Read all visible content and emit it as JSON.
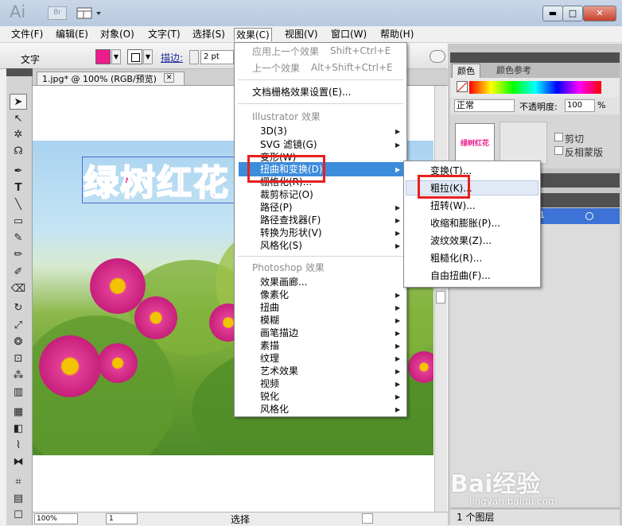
{
  "app": {
    "logo": "Ai",
    "bridge": "Br"
  },
  "window_controls": {
    "minimize": "▬",
    "maximize": "□",
    "close": "✕"
  },
  "menubar": [
    "文件(F)",
    "编辑(E)",
    "对象(O)",
    "文字(T)",
    "选择(S)",
    "效果(C)",
    "视图(V)",
    "窗口(W)",
    "帮助(H)"
  ],
  "control_bar": {
    "mode": "文字",
    "fill_color": "#ec1c8c",
    "stroke_label": "描边:",
    "stroke_value": "2 pt"
  },
  "document_tab": {
    "title": "1.jpg* @ 100% (RGB/预览)",
    "close": "✕"
  },
  "artwork": {
    "text": "绿树红花"
  },
  "status_bar": {
    "zoom": "100%",
    "page": "1",
    "mode": "选择"
  },
  "effects_menu": {
    "apply_last": "应用上一个效果",
    "apply_last_shortcut": "Shift+Ctrl+E",
    "last_effect": "上一个效果",
    "last_effect_shortcut": "Alt+Shift+Ctrl+E",
    "raster_settings": "文档栅格效果设置(E)...",
    "illustrator_section": "Illustrator 效果",
    "illustrator_items": [
      "3D(3)",
      "SVG 滤镜(G)",
      "变形(W)",
      "扭曲和变换(D)",
      "栅格化(R)...",
      "裁剪标记(O)",
      "路径(P)",
      "路径查找器(F)",
      "转换为形状(V)",
      "风格化(S)"
    ],
    "photoshop_section": "Photoshop 效果",
    "photoshop_items": [
      "效果画廊...",
      "像素化",
      "扭曲",
      "模糊",
      "画笔描边",
      "素描",
      "纹理",
      "艺术效果",
      "视频",
      "锐化",
      "风格化"
    ]
  },
  "distort_submenu": [
    "变换(T)...",
    "粗拉(K)...",
    "扭转(W)...",
    "收缩和膨胀(P)...",
    "波纹效果(Z)...",
    "粗糙化(R)...",
    "自由扭曲(F)..."
  ],
  "color_panel": {
    "tab_color": "颜色",
    "tab_color_ref": "颜色参考"
  },
  "transparency_panel": {
    "blend_mode": "正常",
    "opacity_label": "不透明度:",
    "opacity_value": "100",
    "opacity_unit": "%",
    "clip": "剪切",
    "invert_mask": "反相蒙版",
    "thumb_text": "绿树红花"
  },
  "layers_panel": {
    "layer_number": "1",
    "count": "1 个图层"
  },
  "watermark": {
    "brand": "Bai经验",
    "url": "jingyan.baidu.com"
  }
}
